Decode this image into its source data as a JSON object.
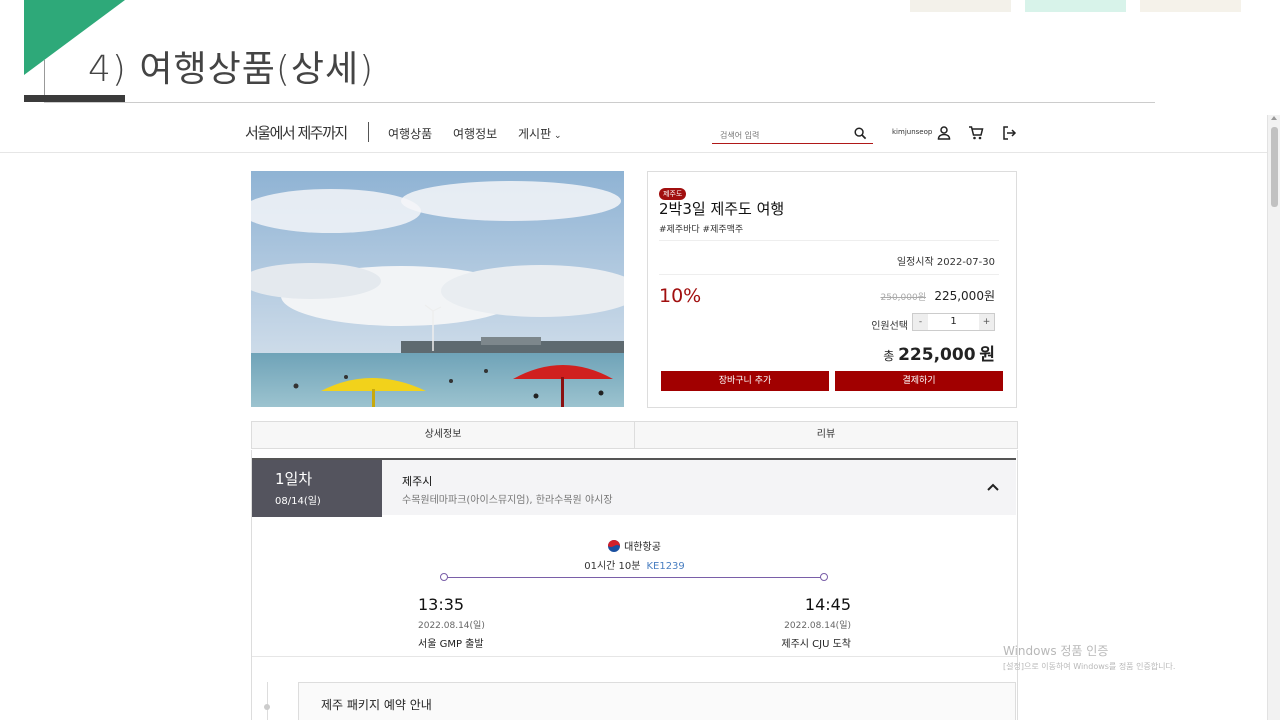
{
  "slide": {
    "title": "4)  여행상품(상세)"
  },
  "nav": {
    "logo": "서울에서 제주까지",
    "links": [
      "여행상품",
      "여행정보",
      "게시판"
    ],
    "search_placeholder": "검색어 입력",
    "username": "kimjunseop",
    "icons": [
      "search-icon",
      "user-icon",
      "cart-icon",
      "logout-icon"
    ]
  },
  "product": {
    "badge": "제주도",
    "title": "2박3일 제주도 여행",
    "tags": "#제주바다 #제주맥주",
    "start_label": "일정시작 2022-07-30",
    "discount": "10%",
    "old_price": "250,000원",
    "price": "225,000원",
    "qty_label": "인원선택",
    "qty_minus": "-",
    "qty_value": "1",
    "qty_plus": "+",
    "total_prefix": "총",
    "total_value": "225,000",
    "total_unit": "원",
    "cart_button": "장바구니 추가",
    "pay_button": "결제하기"
  },
  "tabs": [
    "상세정보",
    "리뷰"
  ],
  "day": {
    "label": "1일차",
    "date": "08/14(일)",
    "city": "제주시",
    "places": "수목원테마파크(아이스뮤지엄), 한라수목원 야시장"
  },
  "flight": {
    "airline": "대한항공",
    "duration": "01시간 10분",
    "flight_no": "KE1239",
    "depart_time": "13:35",
    "depart_date": "2022.08.14(일)",
    "depart_place": "서울 GMP 출발",
    "arrive_time": "14:45",
    "arrive_date": "2022.08.14(일)",
    "arrive_place": "제주시 CJU 도착"
  },
  "notice": {
    "title": "제주 패키지 예약 안내"
  },
  "watermark": {
    "line1": "Windows 정품 인증",
    "line2": "[설정]으로 이동하여 Windows를 정품 인증합니다."
  },
  "colors": {
    "accent_red": "#a10f0f",
    "slide_green": "#2ea979",
    "route_purple": "#7a5fa8"
  }
}
